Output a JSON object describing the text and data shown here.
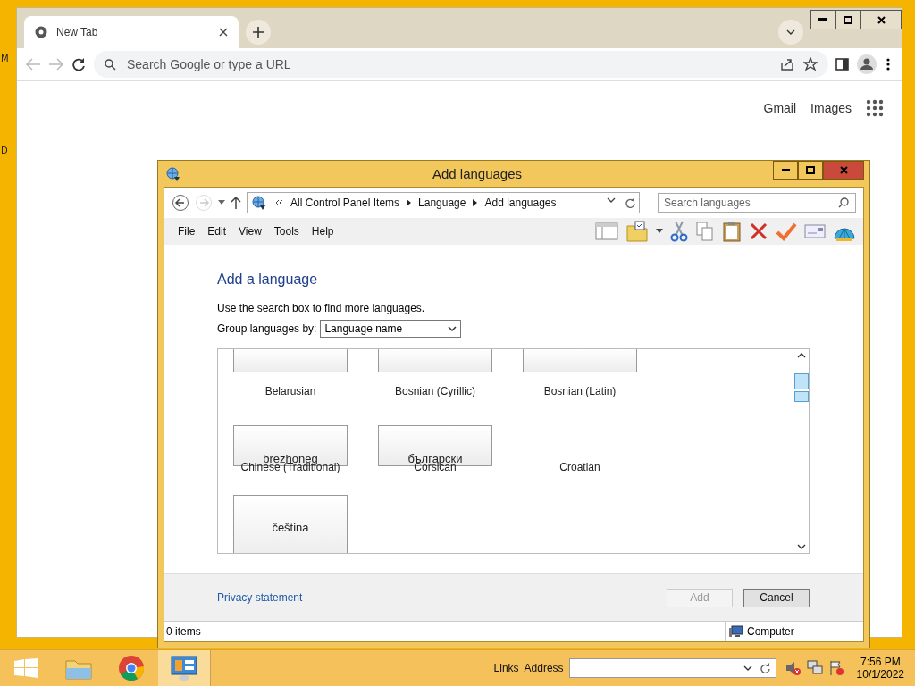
{
  "desktop": {
    "icon_labels": [
      "M",
      "D"
    ]
  },
  "browser": {
    "tabs": [
      {
        "title": "New Tab",
        "selected": true
      }
    ],
    "omnibox": {
      "placeholder": "Search Google or type a URL"
    },
    "links": [
      "Gmail",
      "Images"
    ]
  },
  "dialog": {
    "title": "Add languages",
    "breadcrumb": [
      "All Control Panel Items",
      "Language",
      "Add languages"
    ],
    "search": {
      "placeholder": "Search languages"
    },
    "menu": [
      "File",
      "Edit",
      "View",
      "Tools",
      "Help"
    ],
    "heading": "Add a language",
    "hint": "Use the search box to find more languages.",
    "group_by": {
      "label": "Group languages by:",
      "value": "Language name"
    },
    "tile_rows": [
      {
        "kind": "scrolled",
        "cells": [
          {
            "label": "Belarusian"
          },
          {
            "label": "Bosnian (Cyrillic)"
          },
          {
            "label": "Bosnian (Latin)"
          }
        ]
      },
      {
        "kind": "overlap",
        "cells": [
          {
            "native": "brezhoneg",
            "label": "Chinese (Traditional)"
          },
          {
            "native": "български",
            "label": "Corsican"
          },
          {
            "label": "Croatian"
          }
        ]
      },
      {
        "kind": "full",
        "cells": [
          {
            "native": "čeština"
          }
        ]
      }
    ],
    "privacy_link": "Privacy statement",
    "buttons": [
      {
        "label": "Add",
        "disabled": true
      },
      {
        "label": "Cancel",
        "disabled": false
      }
    ],
    "status": {
      "items": "0 items",
      "zone": "Computer"
    }
  },
  "taskbar": {
    "links": "Links",
    "address_label": "Address",
    "clock": {
      "time": "7:56 PM",
      "date": "10/1/2022"
    }
  }
}
